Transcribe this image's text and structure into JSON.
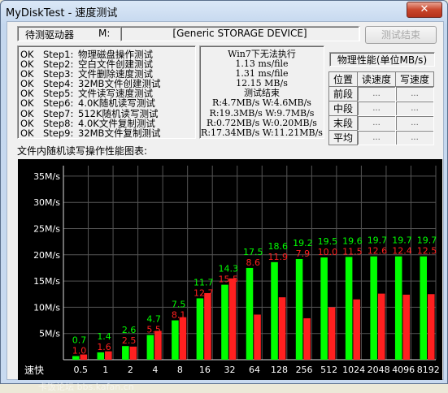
{
  "window": {
    "title": "MyDiskTest - 速度测试",
    "close_glyph": "✕"
  },
  "drive": {
    "label": "待测驱动器",
    "letter": "M:",
    "device": "[Generic STORAGE DEVICE]",
    "end_button": "测试结束"
  },
  "steps": [
    {
      "status": "OK",
      "step": "Step1:",
      "desc": "物理磁盘操作测试",
      "result": "Win7下无法执行"
    },
    {
      "status": "OK",
      "step": "Step2:",
      "desc": "空白文件创建测试",
      "result": "1.13 ms/file"
    },
    {
      "status": "OK",
      "step": "Step3:",
      "desc": "文件删除速度测试",
      "result": "1.31 ms/file"
    },
    {
      "status": "OK",
      "step": "Step4:",
      "desc": "32MB文件创建测试",
      "result": "12.15 MB/s"
    },
    {
      "status": "OK",
      "step": "Step5:",
      "desc": "文件读写速度测试",
      "result": "测试结束"
    },
    {
      "status": "OK",
      "step": "Step6:",
      "desc": "4.0K随机读写测试",
      "result": "R:4.7MB/s W:4.6MB/s"
    },
    {
      "status": "OK",
      "step": "Step7:",
      "desc": "512K随机读写测试",
      "result": "R:19.3MB/s W:9.7MB/s"
    },
    {
      "status": "OK",
      "step": "Step8:",
      "desc": "4.0K文件复制测试",
      "result": "R:0.72MB/s W:0.20MB/s"
    },
    {
      "status": "OK",
      "step": "Step9:",
      "desc": "32MB文件复制测试",
      "result": "R:17.34MB/s W:11.21MB/s"
    }
  ],
  "perf": {
    "title": "物理性能(单位MB/s)",
    "headers": [
      "位置",
      "读速度",
      "写速度"
    ],
    "rows": [
      {
        "pos": "前段",
        "read": "...",
        "write": "..."
      },
      {
        "pos": "中段",
        "read": "...",
        "write": "..."
      },
      {
        "pos": "末段",
        "read": "...",
        "write": "..."
      },
      {
        "pos": "平均",
        "read": "...",
        "write": "..."
      }
    ]
  },
  "chart_title": "文件内随机读写操作性能图表:",
  "watermark": "卡饭论坛 bbs.kafan.cn",
  "chart_data": {
    "type": "bar",
    "x_first_label": "速快",
    "categories": [
      "0.5",
      "1",
      "2",
      "4",
      "8",
      "16",
      "32",
      "64",
      "128",
      "256",
      "512",
      "1024",
      "2048",
      "4096",
      "8192"
    ],
    "ylim": [
      0,
      37
    ],
    "yticks": [
      "5M/s",
      "10M/s",
      "15M/s",
      "20M/s",
      "25M/s",
      "30M/s",
      "35M/s"
    ],
    "ytick_values": [
      5,
      10,
      15,
      20,
      25,
      30,
      35
    ],
    "grid": true,
    "series": [
      {
        "values": [
          0.7,
          1.4,
          2.6,
          4.7,
          7.5,
          11.7,
          14.3,
          17.5,
          18.6,
          19.2,
          19.5,
          19.6,
          19.7,
          19.7,
          19.7
        ],
        "color": "#00ff00"
      },
      {
        "values": [
          1.0,
          1.6,
          2.5,
          5.5,
          8.1,
          12.7,
          15.5,
          8.6,
          11.9,
          7.9,
          10.0,
          11.5,
          12.6,
          12.4,
          12.5
        ],
        "color": "#ff2020"
      }
    ]
  }
}
